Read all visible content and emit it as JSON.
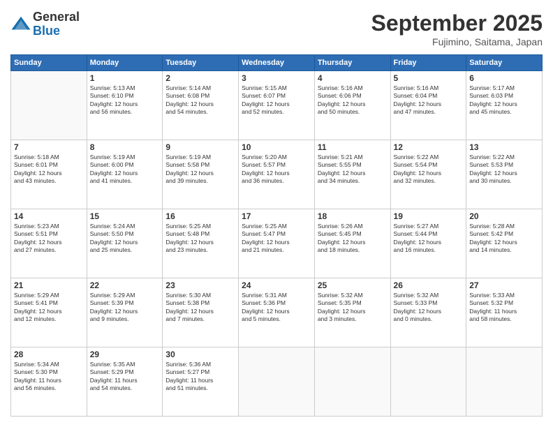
{
  "logo": {
    "general": "General",
    "blue": "Blue"
  },
  "header": {
    "month": "September 2025",
    "location": "Fujimino, Saitama, Japan"
  },
  "weekdays": [
    "Sunday",
    "Monday",
    "Tuesday",
    "Wednesday",
    "Thursday",
    "Friday",
    "Saturday"
  ],
  "weeks": [
    [
      {
        "day": "",
        "content": ""
      },
      {
        "day": "1",
        "content": "Sunrise: 5:13 AM\nSunset: 6:10 PM\nDaylight: 12 hours\nand 56 minutes."
      },
      {
        "day": "2",
        "content": "Sunrise: 5:14 AM\nSunset: 6:08 PM\nDaylight: 12 hours\nand 54 minutes."
      },
      {
        "day": "3",
        "content": "Sunrise: 5:15 AM\nSunset: 6:07 PM\nDaylight: 12 hours\nand 52 minutes."
      },
      {
        "day": "4",
        "content": "Sunrise: 5:16 AM\nSunset: 6:06 PM\nDaylight: 12 hours\nand 50 minutes."
      },
      {
        "day": "5",
        "content": "Sunrise: 5:16 AM\nSunset: 6:04 PM\nDaylight: 12 hours\nand 47 minutes."
      },
      {
        "day": "6",
        "content": "Sunrise: 5:17 AM\nSunset: 6:03 PM\nDaylight: 12 hours\nand 45 minutes."
      }
    ],
    [
      {
        "day": "7",
        "content": "Sunrise: 5:18 AM\nSunset: 6:01 PM\nDaylight: 12 hours\nand 43 minutes."
      },
      {
        "day": "8",
        "content": "Sunrise: 5:19 AM\nSunset: 6:00 PM\nDaylight: 12 hours\nand 41 minutes."
      },
      {
        "day": "9",
        "content": "Sunrise: 5:19 AM\nSunset: 5:58 PM\nDaylight: 12 hours\nand 39 minutes."
      },
      {
        "day": "10",
        "content": "Sunrise: 5:20 AM\nSunset: 5:57 PM\nDaylight: 12 hours\nand 36 minutes."
      },
      {
        "day": "11",
        "content": "Sunrise: 5:21 AM\nSunset: 5:55 PM\nDaylight: 12 hours\nand 34 minutes."
      },
      {
        "day": "12",
        "content": "Sunrise: 5:22 AM\nSunset: 5:54 PM\nDaylight: 12 hours\nand 32 minutes."
      },
      {
        "day": "13",
        "content": "Sunrise: 5:22 AM\nSunset: 5:53 PM\nDaylight: 12 hours\nand 30 minutes."
      }
    ],
    [
      {
        "day": "14",
        "content": "Sunrise: 5:23 AM\nSunset: 5:51 PM\nDaylight: 12 hours\nand 27 minutes."
      },
      {
        "day": "15",
        "content": "Sunrise: 5:24 AM\nSunset: 5:50 PM\nDaylight: 12 hours\nand 25 minutes."
      },
      {
        "day": "16",
        "content": "Sunrise: 5:25 AM\nSunset: 5:48 PM\nDaylight: 12 hours\nand 23 minutes."
      },
      {
        "day": "17",
        "content": "Sunrise: 5:25 AM\nSunset: 5:47 PM\nDaylight: 12 hours\nand 21 minutes."
      },
      {
        "day": "18",
        "content": "Sunrise: 5:26 AM\nSunset: 5:45 PM\nDaylight: 12 hours\nand 18 minutes."
      },
      {
        "day": "19",
        "content": "Sunrise: 5:27 AM\nSunset: 5:44 PM\nDaylight: 12 hours\nand 16 minutes."
      },
      {
        "day": "20",
        "content": "Sunrise: 5:28 AM\nSunset: 5:42 PM\nDaylight: 12 hours\nand 14 minutes."
      }
    ],
    [
      {
        "day": "21",
        "content": "Sunrise: 5:29 AM\nSunset: 5:41 PM\nDaylight: 12 hours\nand 12 minutes."
      },
      {
        "day": "22",
        "content": "Sunrise: 5:29 AM\nSunset: 5:39 PM\nDaylight: 12 hours\nand 9 minutes."
      },
      {
        "day": "23",
        "content": "Sunrise: 5:30 AM\nSunset: 5:38 PM\nDaylight: 12 hours\nand 7 minutes."
      },
      {
        "day": "24",
        "content": "Sunrise: 5:31 AM\nSunset: 5:36 PM\nDaylight: 12 hours\nand 5 minutes."
      },
      {
        "day": "25",
        "content": "Sunrise: 5:32 AM\nSunset: 5:35 PM\nDaylight: 12 hours\nand 3 minutes."
      },
      {
        "day": "26",
        "content": "Sunrise: 5:32 AM\nSunset: 5:33 PM\nDaylight: 12 hours\nand 0 minutes."
      },
      {
        "day": "27",
        "content": "Sunrise: 5:33 AM\nSunset: 5:32 PM\nDaylight: 11 hours\nand 58 minutes."
      }
    ],
    [
      {
        "day": "28",
        "content": "Sunrise: 5:34 AM\nSunset: 5:30 PM\nDaylight: 11 hours\nand 56 minutes."
      },
      {
        "day": "29",
        "content": "Sunrise: 5:35 AM\nSunset: 5:29 PM\nDaylight: 11 hours\nand 54 minutes."
      },
      {
        "day": "30",
        "content": "Sunrise: 5:36 AM\nSunset: 5:27 PM\nDaylight: 11 hours\nand 51 minutes."
      },
      {
        "day": "",
        "content": ""
      },
      {
        "day": "",
        "content": ""
      },
      {
        "day": "",
        "content": ""
      },
      {
        "day": "",
        "content": ""
      }
    ]
  ]
}
